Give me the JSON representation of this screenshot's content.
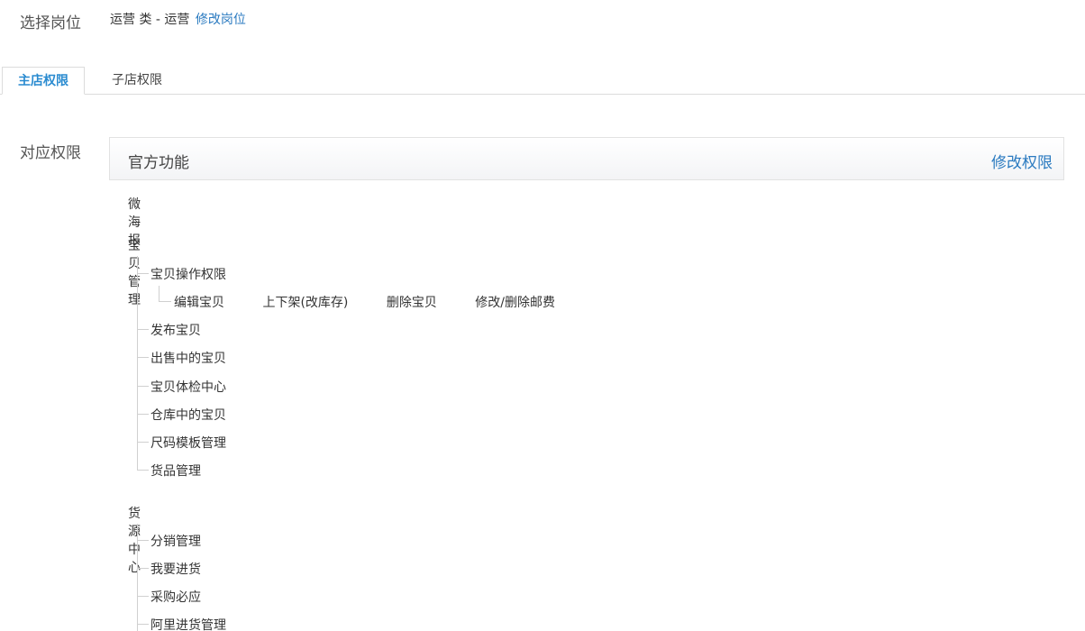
{
  "position": {
    "label": "选择岗位",
    "value": "运营 类 - 运营",
    "edit_link": "修改岗位"
  },
  "tabs": [
    {
      "label": "主店权限",
      "active": true
    },
    {
      "label": "子店权限",
      "active": false
    }
  ],
  "permissions": {
    "label": "对应权限",
    "header_title": "官方功能",
    "edit_link": "修改权限",
    "groups": [
      {
        "title": "微海报"
      },
      {
        "title": "宝贝管理",
        "children": [
          {
            "label": "宝贝操作权限",
            "subitems": [
              "编辑宝贝",
              "上下架(改库存)",
              "删除宝贝",
              "修改/删除邮费"
            ]
          },
          {
            "label": "发布宝贝"
          },
          {
            "label": "出售中的宝贝"
          },
          {
            "label": "宝贝体检中心"
          },
          {
            "label": "仓库中的宝贝"
          },
          {
            "label": "尺码模板管理"
          },
          {
            "label": "货品管理"
          }
        ]
      },
      {
        "title": "货源中心",
        "children": [
          {
            "label": "分销管理"
          },
          {
            "label": "我要进货"
          },
          {
            "label": "采购必应"
          },
          {
            "label": "阿里进货管理"
          }
        ]
      }
    ]
  },
  "colors": {
    "accent": "#2a8bd0",
    "link": "#2a7ac0"
  }
}
